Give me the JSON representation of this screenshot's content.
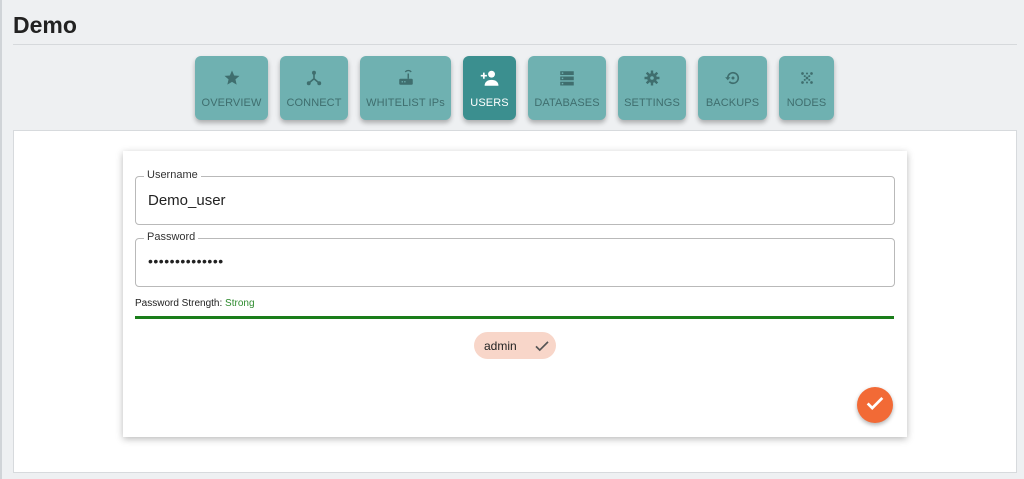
{
  "app": {
    "title": "Demo"
  },
  "nav": {
    "items": [
      {
        "label": "OVERVIEW",
        "icon": "star-icon",
        "active": false
      },
      {
        "label": "CONNECT",
        "icon": "connect-icon",
        "active": false
      },
      {
        "label": "WHITELIST IPs",
        "icon": "router-icon",
        "active": false
      },
      {
        "label": "USERS",
        "icon": "add-user-icon",
        "active": true
      },
      {
        "label": "DATABASES",
        "icon": "database-icon",
        "active": false
      },
      {
        "label": "SETTINGS",
        "icon": "gear-icon",
        "active": false
      },
      {
        "label": "BACKUPS",
        "icon": "backup-restore-icon",
        "active": false
      },
      {
        "label": "NODES",
        "icon": "nodes-icon",
        "active": false
      }
    ]
  },
  "form": {
    "username": {
      "label": "Username",
      "value": "Demo_user"
    },
    "password": {
      "label": "Password",
      "value": "••••••••••••••"
    },
    "strength": {
      "label": "Password Strength:",
      "value": "Strong",
      "level": 1.0,
      "color": "#1a7d1a"
    },
    "role_chip": {
      "label": "admin",
      "selected": true
    },
    "submit": {
      "icon": "check-icon",
      "color": "#f26a36"
    }
  },
  "colors": {
    "nav_button": "#6fb1b1",
    "nav_button_active": "#3b8f8f",
    "chip": "#f8d6c9",
    "strength_ok": "#2e8b2e"
  }
}
